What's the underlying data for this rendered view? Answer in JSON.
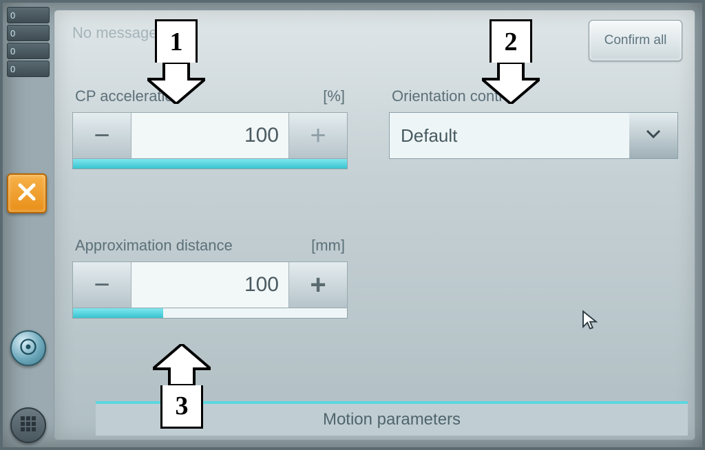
{
  "topbar": {
    "no_messages": "No messages",
    "confirm_all": "Confirm all"
  },
  "left_rail": {
    "badges": [
      "0",
      "0",
      "0",
      "0"
    ]
  },
  "groups": {
    "accel": {
      "label": "CP acceleration",
      "unit": "[%]",
      "value": "100"
    },
    "orient": {
      "label": "Orientation control",
      "value": "Default"
    },
    "approx": {
      "label": "Approximation distance",
      "unit": "[mm]",
      "value": "100"
    }
  },
  "tab": {
    "title": "Motion parameters"
  },
  "annotations": {
    "a1": "1",
    "a2": "2",
    "a3": "3"
  }
}
